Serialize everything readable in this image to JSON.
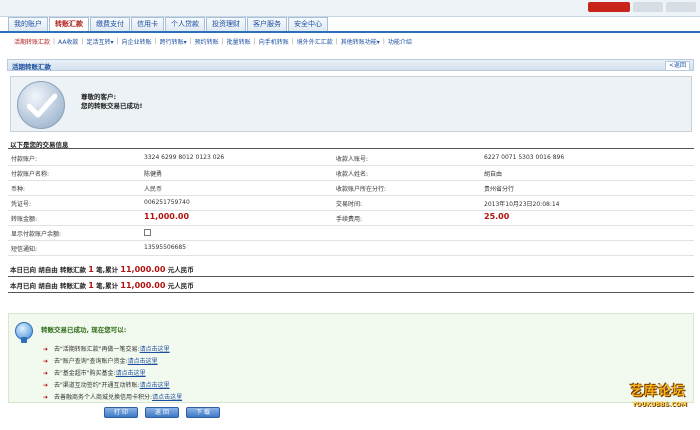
{
  "nav": {
    "tabs": [
      {
        "label": "我的账户"
      },
      {
        "label": "转账汇款"
      },
      {
        "label": "缴费支付"
      },
      {
        "label": "信用卡"
      },
      {
        "label": "个人贷款"
      },
      {
        "label": "投资理财"
      },
      {
        "label": "客户服务"
      },
      {
        "label": "安全中心"
      }
    ],
    "active_tab": "转账汇款"
  },
  "subnav": {
    "items": [
      {
        "label": "活期转账汇款"
      },
      {
        "label": "AA收款"
      },
      {
        "label": "定活互转▾"
      },
      {
        "label": "向企业转账"
      },
      {
        "label": "跨行转账▾"
      },
      {
        "label": "预约转账"
      },
      {
        "label": "批量转账"
      },
      {
        "label": "向手机转账"
      },
      {
        "label": "境外外汇汇款"
      },
      {
        "label": "其他转账功能▾"
      },
      {
        "label": "功能介绍"
      }
    ]
  },
  "page": {
    "title": "活期转账汇款",
    "back_label": "<返回"
  },
  "result": {
    "greeting": "尊敬的客户:",
    "message": "您的转账交易已成功!"
  },
  "info": {
    "heading": "以下是您的交易信息",
    "rows": [
      {
        "l1": "付款账户:",
        "v1": "3324 6299 8012 0123 026",
        "l2": "收款人账号:",
        "v2": "6227 0071 5303 0016 896"
      },
      {
        "l1": "付款账户名称:",
        "v1": "陈健勇",
        "l2": "收款人姓名:",
        "v2": "胡自由"
      },
      {
        "l1": "币种:",
        "v1": "人民币",
        "l2": "收款账户所在分行:",
        "v2": "贵州省分行"
      },
      {
        "l1": "凭证号:",
        "v1": "006251759740",
        "l2": "交易时间:",
        "v2": "2013年10月23日20:08:14"
      },
      {
        "l1": "转账金额:",
        "v1": "11,000.00",
        "l2": "手续费用:",
        "v2": "25.00"
      }
    ],
    "show_balance_label": "显示付款账户余额:",
    "sms_label": "短信通知:",
    "sms_value": "13595506685"
  },
  "summary": {
    "today": {
      "prefix": "本日已向 胡自由 转账汇款",
      "count": "1",
      "mid": "笔,累计",
      "amount": "11,000.00",
      "suffix": "元人民币"
    },
    "month": {
      "prefix": "本月已向 胡自由 转账汇款",
      "count": "1",
      "mid": "笔,累计",
      "amount": "11,000.00",
      "suffix": "元人民币"
    }
  },
  "tips": {
    "title": "转账交易已成功, 现在您可以:",
    "items": [
      {
        "text": "去\"活期转账汇款\"再做一笔交易:",
        "link": "请点击这里"
      },
      {
        "text": "去\"账户查询\"查询账户资金:",
        "link": "请点击这里"
      },
      {
        "text": "去\"基金超市\"购买基金:",
        "link": "请点击这里"
      },
      {
        "text": "去\"渠道互动签约\"开通互动转账:",
        "link": "请点击这里"
      },
      {
        "text": "去善融商务个人商城兑换信用卡积分:",
        "link": "请点击这里"
      }
    ]
  },
  "buttons": {
    "print": "打 印",
    "back": "返 回",
    "download": "下 载"
  },
  "watermark": {
    "top": "艺库论坛",
    "bottom": "YOUKUBBS.COM"
  },
  "colors": {
    "accent_blue": "#2d6fb9",
    "money_red": "#b0140f",
    "tips_green": "#2c6a16"
  }
}
